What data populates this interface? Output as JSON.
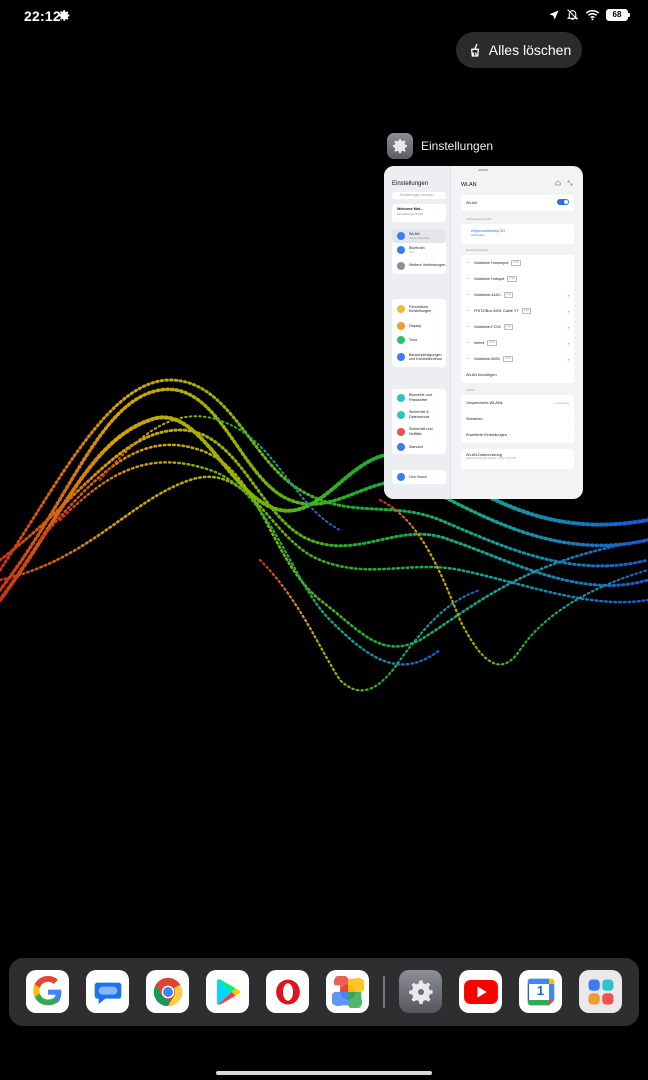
{
  "status_bar": {
    "time": "22:12",
    "battery": "68"
  },
  "recents": {
    "clear_all_label": "Alles löschen",
    "app_title": "Einstellungen"
  },
  "settings_card": {
    "sidebar_title": "Einstellungen",
    "search_placeholder": "Einstellungen durchsu...",
    "account_name": "Welcome Mat...",
    "account_sub": "Einstellungen/Profil",
    "groups": [
      {
        "items": [
          {
            "label": "WLAN",
            "sub": "chlysmobileshop",
            "color": "#3b7cf0",
            "selected": true
          },
          {
            "label": "Bluetooth",
            "sub": "Aus",
            "color": "#3b7cf0",
            "selected": false
          },
          {
            "label": "Weitere Verbindungen",
            "sub": "",
            "color": "#8b8f98",
            "selected": false
          }
        ]
      },
      {
        "items": [
          {
            "label": "Persönliche Einstellungen",
            "sub": "",
            "color": "#f4b93a",
            "selected": false
          },
          {
            "label": "Display",
            "sub": "",
            "color": "#f39a2f",
            "selected": false
          },
          {
            "label": "Töne",
            "sub": "",
            "color": "#2fbf71",
            "selected": false
          },
          {
            "label": "Benachrichtigungen und Kontrollzentrum",
            "sub": "",
            "color": "#3b7cf0",
            "selected": false
          }
        ]
      },
      {
        "items": [
          {
            "label": "Biometrie und Passwörter",
            "sub": "",
            "color": "#2fc3c9",
            "selected": false
          },
          {
            "label": "Sicherheit & Datenschutz",
            "sub": "",
            "color": "#2fc3c9",
            "selected": false
          },
          {
            "label": "Sicherheit und Notfälle",
            "sub": "",
            "color": "#f05050",
            "selected": false
          },
          {
            "label": "Standort",
            "sub": "",
            "color": "#3b7cf0",
            "selected": false
          }
        ]
      },
      {
        "items": [
          {
            "label": "Oxo Vision",
            "sub": "",
            "color": "#3b7cf0",
            "selected": false
          }
        ]
      }
    ],
    "wifi_title": "WLAN",
    "wifi_toggle_label": "WLAN",
    "connected_section": "Verbundenes WLAN",
    "connected_network": "chlysmobileshop 5G",
    "connected_badge": "5G",
    "connected_sub": "Verbunden",
    "available_section": "WLAN auswählen",
    "networks": [
      {
        "name": "Vodafone Homespot",
        "badge": "2.4G",
        "locked": false
      },
      {
        "name": "Vodafone Hotspot",
        "badge": "2.4G",
        "locked": false
      },
      {
        "name": "Vodafone-44AC",
        "badge": "2.4G",
        "locked": true
      },
      {
        "name": "FRITZ!Box 6591 Cable YT",
        "badge": "2.4G",
        "locked": true
      },
      {
        "name": "Vodafone-FC04",
        "badge": "2.4G",
        "locked": true
      },
      {
        "name": "Inetes",
        "badge": "2.4G",
        "locked": true
      },
      {
        "name": "Vodafone-569C",
        "badge": "2.4G",
        "locked": true
      }
    ],
    "add_network": "WLAN hinzufügen",
    "more_section": "Andere",
    "saved_networks": "Gespeicherte WLANs",
    "saved_count": "1 Netzwerk",
    "streaming": "Streamen",
    "advanced": "Erweiterte Einstellungen",
    "data_usage": "WLAN-Datennutzung",
    "data_usage_sub": "Datennutzung der letzten 7 Tage 1,19 GB"
  },
  "dock": {
    "apps": [
      {
        "name": "Google",
        "icon": "google-icon"
      },
      {
        "name": "Messages",
        "icon": "messages-icon"
      },
      {
        "name": "Chrome",
        "icon": "chrome-icon"
      },
      {
        "name": "Play Store",
        "icon": "play-store-icon"
      },
      {
        "name": "Opera",
        "icon": "opera-icon"
      },
      {
        "name": "Photos",
        "icon": "photos-icon"
      },
      {
        "name": "Einstellungen",
        "icon": "settings-icon"
      },
      {
        "name": "YouTube",
        "icon": "youtube-icon"
      },
      {
        "name": "Calendar",
        "icon": "calendar-icon"
      },
      {
        "name": "App Drawer",
        "icon": "app-drawer-icon"
      }
    ],
    "calendar_day": "1"
  },
  "colors": {
    "accent": "#2d6fe0",
    "dock_bg": "#404044",
    "clear_button_bg": "#2b2b2e"
  }
}
